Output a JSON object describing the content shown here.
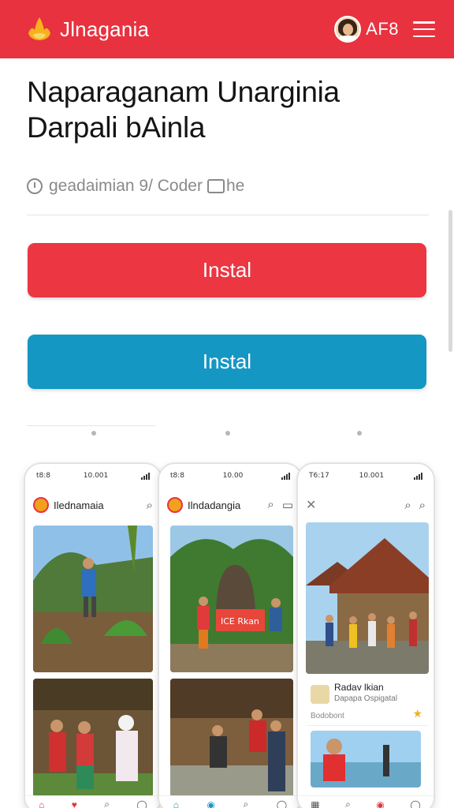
{
  "header": {
    "brand": "Jlnagania",
    "code": "AF8",
    "bg_color": "#e8323f"
  },
  "title": {
    "line1": "Naparaganam Unarginia",
    "line2": "Darpali bAinla"
  },
  "meta": {
    "text": "geadaimian 9/ Coder",
    "suffix": "he",
    "icon_left": "clock-icon",
    "icon_right": "device-icon"
  },
  "buttons": {
    "primary_label": "Instal",
    "secondary_label": "Instal",
    "primary_color": "#ec3642",
    "secondary_color": "#1597c4"
  },
  "screenshots": {
    "phone1": {
      "time": "t8:8",
      "clock": "10.001",
      "app_name": "Ilednamaia"
    },
    "phone2": {
      "time": "t8:8",
      "clock": "10.00",
      "app_name": "Ilndadangia",
      "banner_text": "ICE Rkan"
    },
    "phone3": {
      "time": "T6:17",
      "clock": "10.001",
      "card_title": "Radav lkian",
      "card_subtitle": "Dapapa Ospigatal",
      "card_meta": "Bodobont"
    }
  }
}
